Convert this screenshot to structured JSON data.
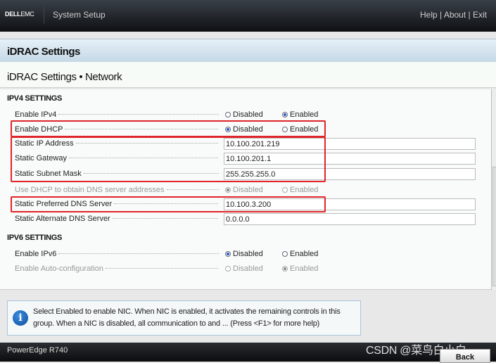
{
  "topbar": {
    "logo": "DELL",
    "logo_suffix": "EMC",
    "title": "System Setup",
    "links": [
      "Help",
      "About",
      "Exit"
    ],
    "separator": " | "
  },
  "header": {
    "title": "iDRAC Settings"
  },
  "subheader": {
    "title": "iDRAC Settings • Network"
  },
  "ipv4": {
    "heading": "IPV4 SETTINGS",
    "enable_ipv4": {
      "label": "Enable IPv4",
      "options": [
        "Disabled",
        "Enabled"
      ],
      "selected": "Enabled"
    },
    "enable_dhcp": {
      "label": "Enable DHCP",
      "options": [
        "Disabled",
        "Enabled"
      ],
      "selected": "Disabled"
    },
    "static_ip": {
      "label": "Static IP Address",
      "value": "10.100.201.219"
    },
    "static_gateway": {
      "label": "Static Gateway",
      "value": "10.100.201.1"
    },
    "static_subnet": {
      "label": "Static Subnet Mask",
      "value": "255.255.255.0"
    },
    "dns_from_dhcp": {
      "label": "Use DHCP to obtain DNS server addresses",
      "options": [
        "Disabled",
        "Enabled"
      ],
      "selected": "Disabled",
      "disabled": true
    },
    "preferred_dns": {
      "label": "Static Preferred DNS Server",
      "value": "10.100.3.200"
    },
    "alternate_dns": {
      "label": "Static Alternate DNS Server",
      "value": "0.0.0.0"
    }
  },
  "ipv6": {
    "heading": "IPV6 SETTINGS",
    "enable_ipv6": {
      "label": "Enable IPv6",
      "options": [
        "Disabled",
        "Enabled"
      ],
      "selected": "Disabled"
    },
    "auto_config": {
      "label": "Enable Auto-configuration",
      "options": [
        "Disabled",
        "Enabled"
      ],
      "selected": "Enabled",
      "disabled": true
    }
  },
  "help": {
    "icon": "info-icon",
    "text": "Select Enabled to enable NIC. When NIC is enabled, it activates the remaining controls in this group. When a NIC is disabled, all communication to and ... (Press <F1> for more help)"
  },
  "footer": {
    "model": "PowerEdge R740",
    "back_label": "Back"
  },
  "watermark": "CSDN @菜鸟白小白",
  "colors": {
    "highlight_box": "#e0242a",
    "radio_selected": "#2a5bc8",
    "header_band": "#c6d8e6"
  }
}
